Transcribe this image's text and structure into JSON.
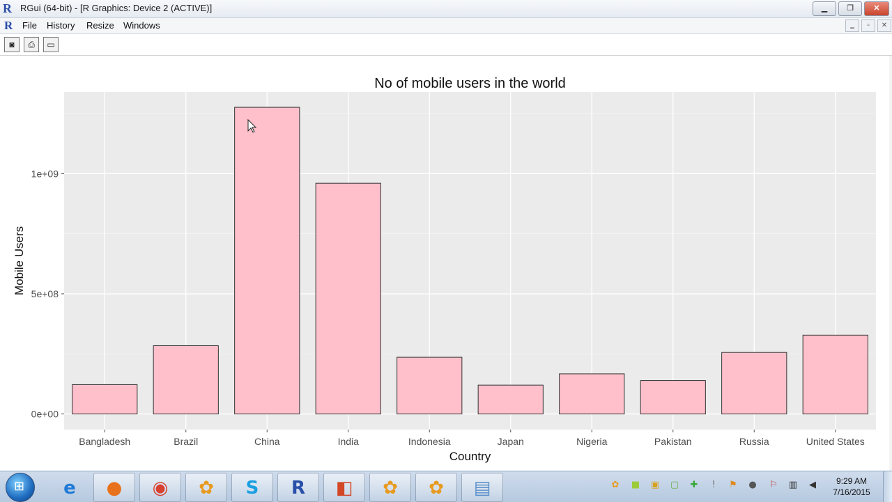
{
  "window": {
    "app_icon": "R",
    "title": "RGui (64-bit) - [R Graphics: Device 2 (ACTIVE)]",
    "controls": {
      "minimize": "▁",
      "restore": "❐",
      "close": "✕"
    }
  },
  "menu": {
    "icon": "R",
    "items": [
      "File",
      "History",
      "Resize",
      "Windows"
    ],
    "mdi": {
      "minimize": "‗",
      "restore": "▫",
      "close": "✕"
    }
  },
  "toolbar": {
    "buttons": [
      {
        "icon": "camera-icon",
        "glyph": "◙"
      },
      {
        "icon": "printer-icon",
        "glyph": "⎙"
      },
      {
        "icon": "window-icon",
        "glyph": "▭"
      }
    ]
  },
  "chart_data": {
    "type": "bar",
    "title": "No of mobile users in the world",
    "xlabel": "Country",
    "ylabel": "Mobile Users",
    "categories": [
      "Bangladesh",
      "Brazil",
      "China",
      "India",
      "Indonesia",
      "Japan",
      "Nigeria",
      "Pakistan",
      "Russia",
      "United States"
    ],
    "values": [
      122000000,
      284000000,
      1276000000,
      960000000,
      236000000,
      120000000,
      167000000,
      139000000,
      256000000,
      328000000
    ],
    "yticks": [
      {
        "value": 0,
        "label": "0e+00"
      },
      {
        "value": 500000000,
        "label": "5e+08"
      },
      {
        "value": 1000000000,
        "label": "1e+09"
      }
    ],
    "ylim": [
      -65000000,
      1340000000
    ],
    "grid": true,
    "colors": {
      "bar_fill": "#ffc0cb",
      "bar_stroke": "#333333",
      "panel": "#ebebeb",
      "grid": "#ffffff"
    }
  },
  "taskbar": {
    "start_icon": "windows-start-icon",
    "start_glyph": "⊞",
    "apps": [
      {
        "name": "internet-explorer",
        "glyph": "e",
        "color": "#1f7ad6"
      },
      {
        "name": "firefox",
        "glyph": "●",
        "color": "#e8721b"
      },
      {
        "name": "chrome",
        "glyph": "◉",
        "color": "#d8412f"
      },
      {
        "name": "flower-app",
        "glyph": "✿",
        "color": "#e89a1e"
      },
      {
        "name": "skype",
        "glyph": "S",
        "color": "#1b9fe0"
      },
      {
        "name": "r-gui",
        "glyph": "R",
        "color": "#2a4fa8"
      },
      {
        "name": "powerpoint",
        "glyph": "◧",
        "color": "#d24726"
      },
      {
        "name": "flower-app-2",
        "glyph": "✿",
        "color": "#e89a1e"
      },
      {
        "name": "flower-app-3",
        "glyph": "✿",
        "color": "#e89a1e"
      },
      {
        "name": "notepad",
        "glyph": "▤",
        "color": "#5a8fc9"
      }
    ],
    "tray_icons": [
      {
        "name": "flower-tray-icon",
        "glyph": "✿",
        "color": "#e89a1e"
      },
      {
        "name": "green-tray-icon",
        "glyph": "■",
        "color": "#9ccc3a"
      },
      {
        "name": "archive-tray-icon",
        "glyph": "▣",
        "color": "#d7a21f"
      },
      {
        "name": "note-tray-icon",
        "glyph": "▢",
        "color": "#6ab04c"
      },
      {
        "name": "add-tray-icon",
        "glyph": "✚",
        "color": "#3aa83a"
      },
      {
        "name": "info-tray-icon",
        "glyph": "!",
        "color": "#777777"
      },
      {
        "name": "flag-tray-icon",
        "glyph": "⚑",
        "color": "#e08a1e"
      },
      {
        "name": "chat-tray-icon",
        "glyph": "●",
        "color": "#555555"
      },
      {
        "name": "action-center-icon",
        "glyph": "⚐",
        "color": "#c0392b"
      },
      {
        "name": "network-icon",
        "glyph": "▥",
        "color": "#333333"
      },
      {
        "name": "volume-icon",
        "glyph": "◀",
        "color": "#333333"
      }
    ],
    "time": "9:29 AM",
    "date": "7/16/2015"
  }
}
